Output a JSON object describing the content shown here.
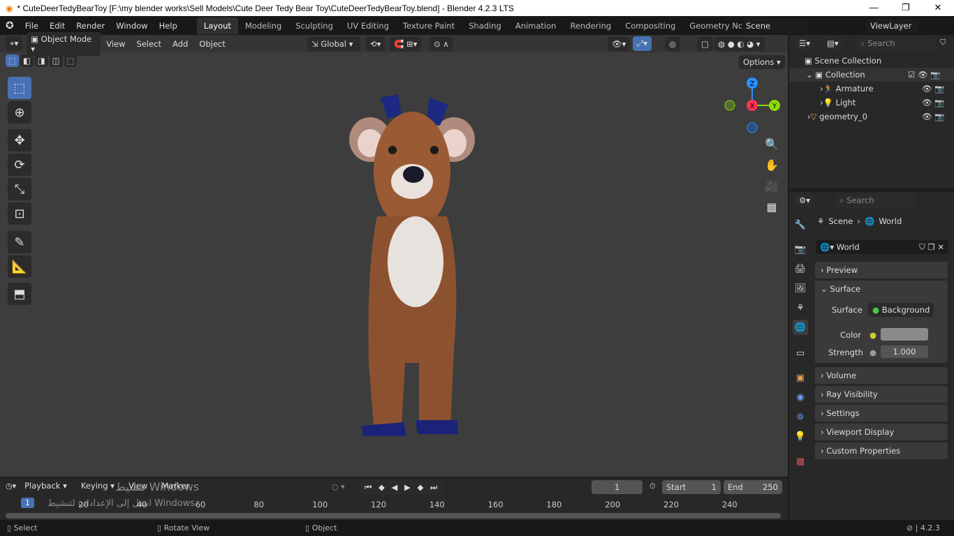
{
  "window": {
    "title": "* CuteDeerTedyBearToy [F:\\my blender works\\Sell Models\\Cute Deer Tedy Bear Toy\\CuteDeerTedyBearToy.blend] - Blender 4.2.3 LTS"
  },
  "menu": [
    "File",
    "Edit",
    "Render",
    "Window",
    "Help"
  ],
  "workspaces": [
    "Layout",
    "Modeling",
    "Sculpting",
    "UV Editing",
    "Texture Paint",
    "Shading",
    "Animation",
    "Rendering",
    "Compositing",
    "Geometry Nodes"
  ],
  "scene": "Scene",
  "view_layer": "ViewLayer",
  "header": {
    "mode": "Object Mode",
    "menus": [
      "View",
      "Select",
      "Add",
      "Object"
    ],
    "orientation": "Global",
    "options": "Options"
  },
  "gizmo": {
    "x": "X",
    "y": "Y",
    "z": "Z",
    "colors": {
      "x": "#ff3352",
      "y": "#8bdc00",
      "z": "#2890ff"
    }
  },
  "outliner": {
    "search_placeholder": "Search",
    "items": [
      {
        "label": "Scene Collection"
      },
      {
        "label": "Collection"
      },
      {
        "label": "Armature"
      },
      {
        "label": "Light"
      },
      {
        "label": "geometry_0"
      }
    ]
  },
  "properties": {
    "search_placeholder": "Search",
    "breadcrumb": [
      "Scene",
      "World"
    ],
    "world_name": "World",
    "panels": {
      "preview": "Preview",
      "surface": "Surface",
      "volume": "Volume",
      "ray_visibility": "Ray Visibility",
      "settings": "Settings",
      "viewport_display": "Viewport Display",
      "custom_properties": "Custom Properties"
    },
    "surface_label": "Surface",
    "surface_value": "Background",
    "color_label": "Color",
    "color_value": "#8a8a8a",
    "strength_label": "Strength",
    "strength_value": "1.000"
  },
  "timeline": {
    "menus": [
      "Playback",
      "Keying",
      "View",
      "Marker"
    ],
    "current_frame": "1",
    "start_label": "Start",
    "start": "1",
    "end_label": "End",
    "end": "250",
    "ticks": [
      "20",
      "40",
      "60",
      "80",
      "100",
      "120",
      "140",
      "160",
      "180",
      "200",
      "220",
      "240"
    ]
  },
  "status": {
    "select": "Select",
    "rotate": "Rotate View",
    "object": "Object",
    "version": "4.2.3"
  },
  "watermark": {
    "line1": "تنشيط Windows",
    "line2": "انتقل إلى الإعدادات لتنشيط Windows."
  },
  "accent": "#4772b3"
}
